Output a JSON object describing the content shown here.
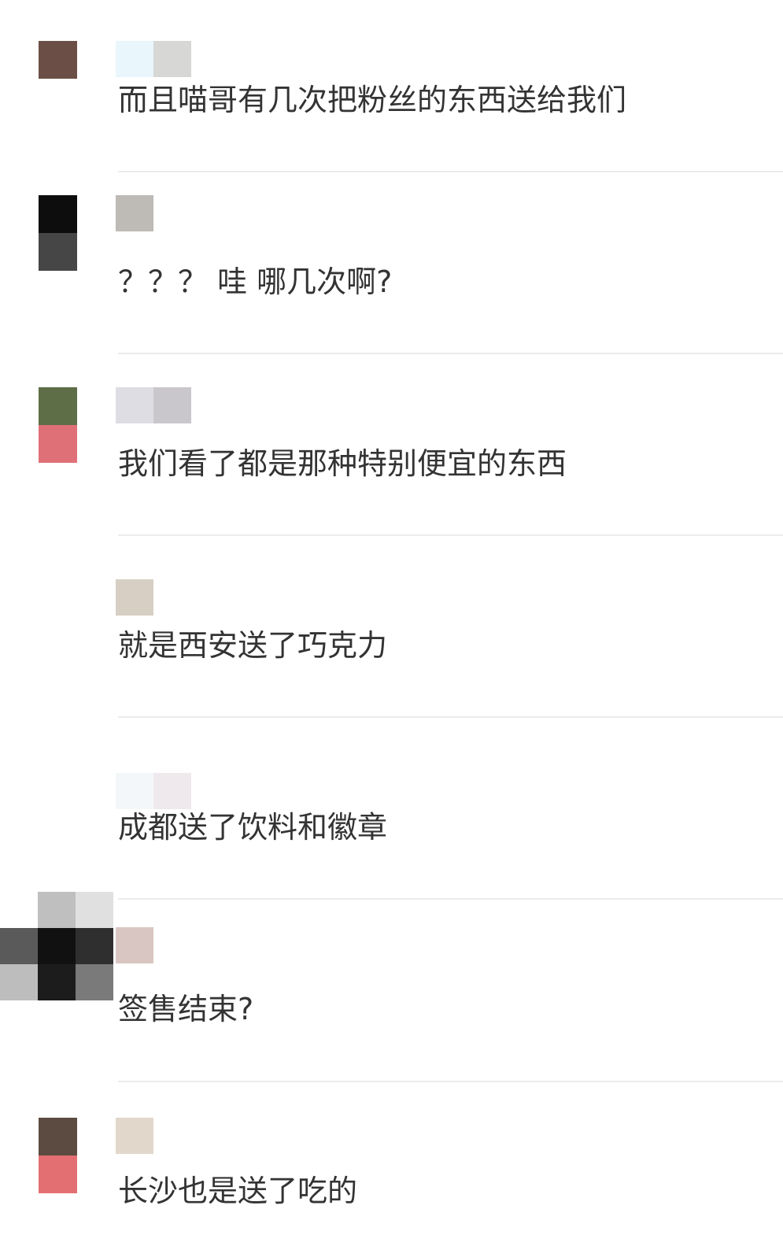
{
  "comments": [
    {
      "text": "而且喵哥有几次把粉丝的东西送给我们",
      "avatar_colors": [
        "#6b4f46"
      ],
      "name_colors": [
        "#e9f6fb",
        "#d7d7d5"
      ]
    },
    {
      "text": "？？？ 哇 哪几次啊?",
      "avatar_colors": [
        "#0d0d0d",
        "#464646"
      ],
      "name_colors": [
        "#bebab5"
      ]
    },
    {
      "text": "我们看了都是那种特别便宜的东西",
      "avatar_colors": [
        "#5e6e47",
        "#e07078"
      ],
      "name_colors": [
        "#dfdde4",
        "#c9c7cb"
      ]
    },
    {
      "text": "就是西安送了巧克力",
      "avatar_colors": [],
      "name_colors": [
        "#d7cfc4"
      ]
    },
    {
      "text": "成都送了饮料和徽章",
      "avatar_colors": [],
      "name_colors": [
        "#f4f7fa",
        "#efe9ee"
      ]
    },
    {
      "text": "签售结束?",
      "avatar_colors": [
        "#111111",
        "#555555"
      ],
      "name_colors": [
        "#d9c6c2"
      ]
    },
    {
      "text": "长沙也是送了吃的",
      "avatar_colors": [
        "#5b4b40",
        "#e36f73"
      ],
      "name_colors": [
        "#e2d7cb"
      ]
    }
  ]
}
